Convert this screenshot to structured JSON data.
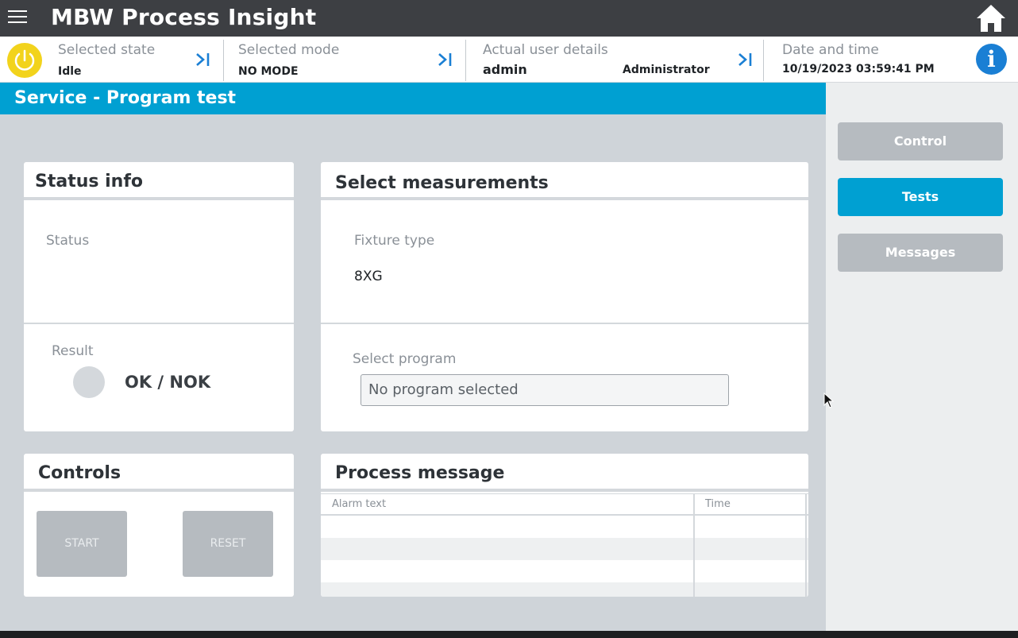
{
  "app": {
    "title": "MBW Process Insight"
  },
  "status_strip": {
    "state": {
      "label": "Selected state",
      "value": "Idle"
    },
    "mode": {
      "label": "Selected mode",
      "value": "NO MODE"
    },
    "user": {
      "label": "Actual user details",
      "name": "admin",
      "role": "Administrator"
    },
    "datetime": {
      "label": "Date and time",
      "value": "10/19/2023 03:59:41 PM"
    },
    "info_glyph": "i"
  },
  "page": {
    "title": "Service - Program test"
  },
  "nav": {
    "items": [
      {
        "label": "Control",
        "active": false
      },
      {
        "label": "Tests",
        "active": true
      },
      {
        "label": "Messages",
        "active": false
      }
    ]
  },
  "status_info": {
    "title": "Status info",
    "status_label": "Status",
    "result_label": "Result",
    "result_text": "OK / NOK"
  },
  "select_measurements": {
    "title": "Select measurements",
    "fixture_label": "Fixture type",
    "fixture_value": "8XG",
    "program_label": "Select program",
    "program_value": "No program selected"
  },
  "controls": {
    "title": "Controls",
    "start_label": "START",
    "reset_label": "RESET"
  },
  "process_message": {
    "title": "Process message",
    "columns": [
      "Alarm text",
      "Time"
    ],
    "rows": []
  },
  "colors": {
    "accent": "#00a0d2",
    "power": "#f2d31c",
    "info": "#1a7fd4",
    "topbar": "#3d3f43"
  }
}
